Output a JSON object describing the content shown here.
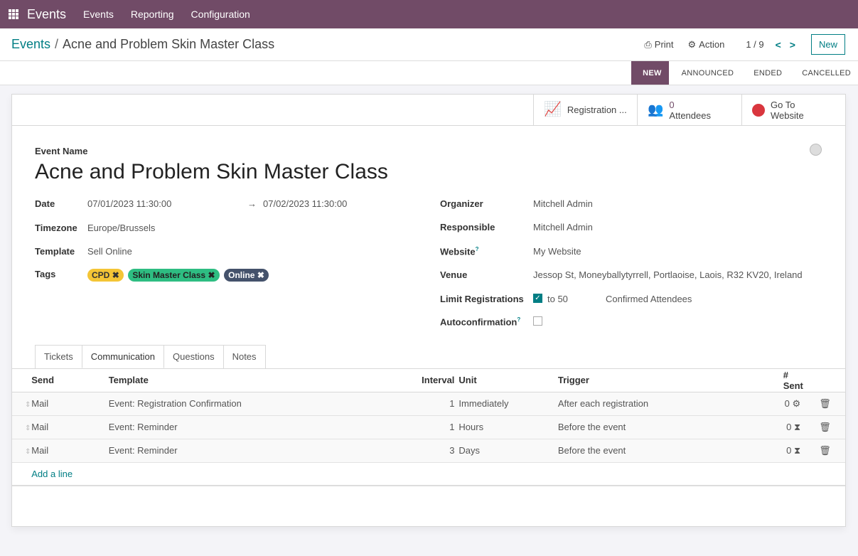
{
  "navbar": {
    "app": "Events",
    "menu": [
      "Events",
      "Reporting",
      "Configuration"
    ]
  },
  "breadcrumb": {
    "parent": "Events",
    "current": "Acne and Problem Skin Master Class"
  },
  "toolbar": {
    "print": "Print",
    "action": "Action",
    "pager": "1 / 9",
    "new": "New"
  },
  "stages": [
    "NEW",
    "ANNOUNCED",
    "ENDED",
    "CANCELLED"
  ],
  "smart_buttons": {
    "registration": "Registration ...",
    "attendees_count": "0",
    "attendees_label": "Attendees",
    "website_line1": "Go To",
    "website_line2": "Website"
  },
  "form": {
    "name_label": "Event Name",
    "name": "Acne and Problem Skin Master Class",
    "date_label": "Date",
    "date_start": "07/01/2023 11:30:00",
    "date_end": "07/02/2023 11:30:00",
    "timezone_label": "Timezone",
    "timezone": "Europe/Brussels",
    "template_label": "Template",
    "template": "Sell Online",
    "tags_label": "Tags",
    "tags": [
      {
        "name": "CPD",
        "color": "#f4c536"
      },
      {
        "name": "Skin Master Class",
        "color": "#2ebd82"
      },
      {
        "name": "Online",
        "color": "#44526b"
      }
    ],
    "organizer_label": "Organizer",
    "organizer": "Mitchell Admin",
    "responsible_label": "Responsible",
    "responsible": "Mitchell Admin",
    "website_label": "Website",
    "website": "My Website",
    "venue_label": "Venue",
    "venue": "Jessop St, Moneyballytyrrell, Portlaoise, Laois, R32 KV20, Ireland",
    "limit_label": "Limit Registrations",
    "limit_checked": true,
    "limit_to": "to 50",
    "limit_suffix": "Confirmed Attendees",
    "autoconfirm_label": "Autoconfirmation",
    "autoconfirm_checked": false
  },
  "tabs": [
    "Tickets",
    "Communication",
    "Questions",
    "Notes"
  ],
  "table": {
    "headers": [
      "Send",
      "Template",
      "Interval",
      "Unit",
      "Trigger",
      "# Sent"
    ],
    "rows": [
      {
        "send": "Mail",
        "template": "Event: Registration Confirmation",
        "interval": "1",
        "unit": "Immediately",
        "trigger": "After each registration",
        "sent": "0",
        "status_icon": "gears-icon"
      },
      {
        "send": "Mail",
        "template": "Event: Reminder",
        "interval": "1",
        "unit": "Hours",
        "trigger": "Before the event",
        "sent": "0",
        "status_icon": "hourglass-icon"
      },
      {
        "send": "Mail",
        "template": "Event: Reminder",
        "interval": "3",
        "unit": "Days",
        "trigger": "Before the event",
        "sent": "0",
        "status_icon": "hourglass-icon"
      }
    ],
    "add_line": "Add a line"
  }
}
